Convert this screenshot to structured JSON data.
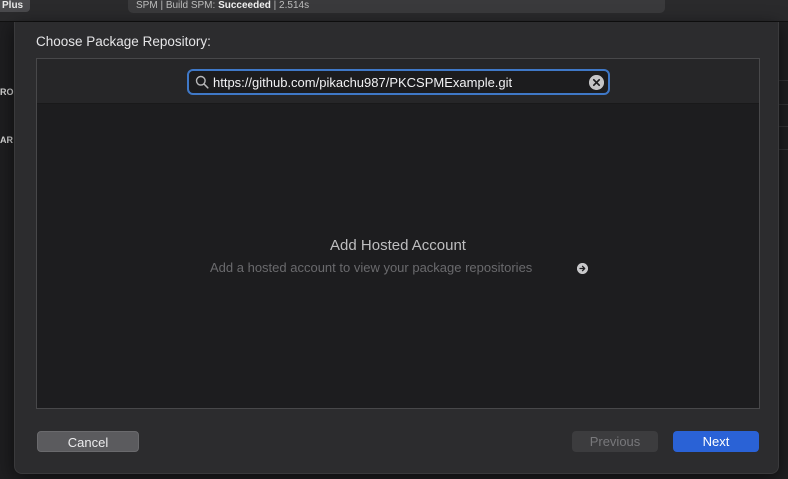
{
  "background": {
    "device_label": "Plus",
    "status": {
      "prefix": "SPM | Build SPM: ",
      "result": "Succeeded",
      "sep": " | ",
      "duration": "2.514s"
    },
    "left_labels": [
      "RO",
      "AR"
    ]
  },
  "sheet": {
    "title": "Choose Package Repository:",
    "search": {
      "value": "https://github.com/pikachu987/PKCSPMExample.git",
      "placeholder": ""
    },
    "empty_state": {
      "title": "Add Hosted Account",
      "subtitle": "Add a hosted account to view your package repositories"
    },
    "buttons": {
      "cancel": "Cancel",
      "previous": "Previous",
      "next": "Next"
    }
  },
  "colors": {
    "accent": "#2a62d6",
    "focus_ring": "#3f78c7",
    "sheet_bg": "#2c2c2e",
    "content_bg": "#1d1d1f"
  },
  "icons": {
    "search": "magnifying-glass",
    "clear": "x-circle-fill",
    "arrow": "arrow-right-circle-fill"
  }
}
